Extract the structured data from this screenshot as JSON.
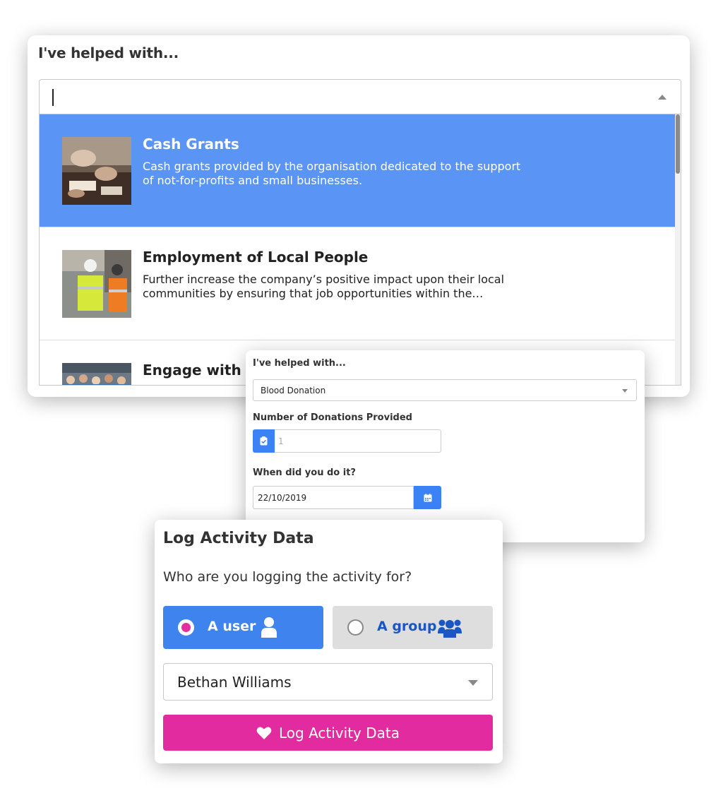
{
  "helped_panel": {
    "title": "I've helped with...",
    "search_value": "",
    "options": [
      {
        "title": "Cash Grants",
        "description": "Cash grants provided by the organisation dedicated to the support of not-for-profits and small businesses.",
        "selected": true
      },
      {
        "title": "Employment of Local People",
        "description": "Further increase the company’s positive impact upon their local communities by ensuring that job opportunities within the…",
        "selected": false
      },
      {
        "title": "Engage with Loc",
        "description": "",
        "selected": false
      }
    ]
  },
  "detail_form": {
    "helped_label": "I've helped with...",
    "helped_value": "Blood Donation",
    "donations_label": "Number of Donations Provided",
    "donations_placeholder": "1",
    "date_label": "When did you do it?",
    "date_value": "22/10/2019"
  },
  "log_activity": {
    "title": "Log Activity Data",
    "question": "Who are you logging the activity for?",
    "user_option": "A user",
    "group_option": "A group",
    "selected_option": "user",
    "person_value": "Bethan Williams",
    "submit_label": "Log Activity Data"
  },
  "colors": {
    "accent_blue": "#5a95f5",
    "button_blue": "#3f84ee",
    "submit_pink": "#e22b9f",
    "radio_selected": "#e0319e"
  }
}
